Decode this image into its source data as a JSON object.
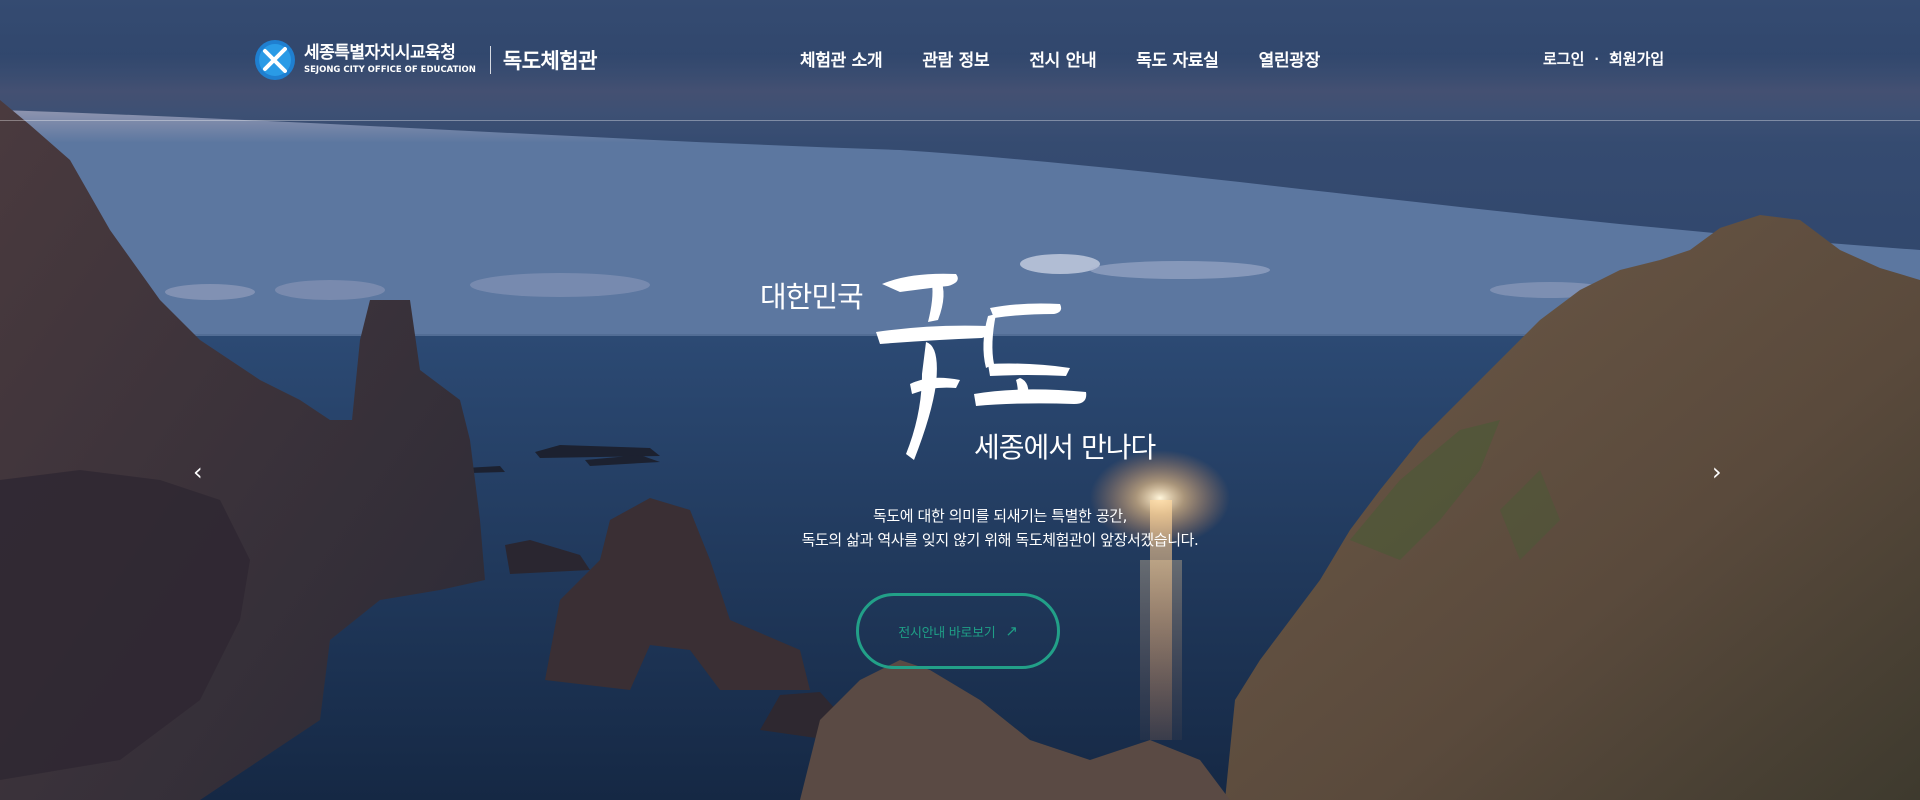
{
  "header": {
    "logo_org_ko": "세종특별자치시교육청",
    "logo_org_en": "SEJONG CITY OFFICE OF EDUCATION",
    "site_name": "독도체험관",
    "nav": [
      "체험관 소개",
      "관람 정보",
      "전시 안내",
      "독도 자료실",
      "열린광장"
    ],
    "util": {
      "login": "로그인",
      "separator": "·",
      "signup": "회원가입"
    }
  },
  "hero": {
    "country": "대한민국",
    "title": "독도",
    "subtitle": "세종에서 만나다",
    "desc_line1": "독도에 대한 의미를 되새기는 특별한 공간,",
    "desc_line2": "독도의 삶과 역사를 잊지 않기 위해 독도체험관이 앞장서겠습니다.",
    "cta_label": "전시안내 바로보기",
    "cta_icon": "arrow-up-right-icon"
  },
  "slider": {
    "prev_icon": "chevron-left-icon",
    "next_icon": "chevron-right-icon"
  },
  "colors": {
    "accent": "#22a088",
    "sky_top": "#2e4670",
    "sea": "#233a5e"
  }
}
